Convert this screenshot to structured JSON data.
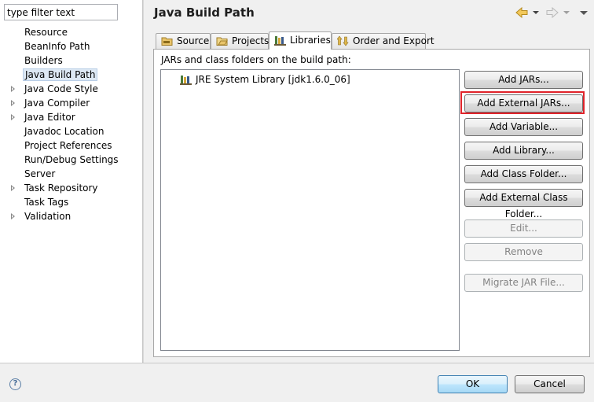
{
  "filter": {
    "placeholder": "type filter text"
  },
  "tree": {
    "items": [
      {
        "label": "Resource",
        "expandable": false,
        "selected": false
      },
      {
        "label": "BeanInfo Path",
        "expandable": false,
        "selected": false
      },
      {
        "label": "Builders",
        "expandable": false,
        "selected": false
      },
      {
        "label": "Java Build Path",
        "expandable": false,
        "selected": true
      },
      {
        "label": "Java Code Style",
        "expandable": true,
        "selected": false
      },
      {
        "label": "Java Compiler",
        "expandable": true,
        "selected": false
      },
      {
        "label": "Java Editor",
        "expandable": true,
        "selected": false
      },
      {
        "label": "Javadoc Location",
        "expandable": false,
        "selected": false
      },
      {
        "label": "Project References",
        "expandable": false,
        "selected": false
      },
      {
        "label": "Run/Debug Settings",
        "expandable": false,
        "selected": false
      },
      {
        "label": "Server",
        "expandable": false,
        "selected": false
      },
      {
        "label": "Task Repository",
        "expandable": true,
        "selected": false
      },
      {
        "label": "Task Tags",
        "expandable": false,
        "selected": false
      },
      {
        "label": "Validation",
        "expandable": true,
        "selected": false
      }
    ]
  },
  "header": {
    "title": "Java Build Path"
  },
  "tabs": [
    {
      "label": "Source",
      "icon": "source-folder-icon",
      "active": false
    },
    {
      "label": "Projects",
      "icon": "projects-icon",
      "active": false
    },
    {
      "label": "Libraries",
      "icon": "libraries-icon",
      "active": true
    },
    {
      "label": "Order and Export",
      "icon": "order-export-icon",
      "active": false
    }
  ],
  "libraries": {
    "caption": "JARs and class folders on the build path:",
    "entries": [
      {
        "label": "JRE System Library [jdk1.6.0_06]",
        "icon": "jre-library-icon"
      }
    ]
  },
  "buttons": {
    "add_jars": "Add JARs...",
    "add_external_jars": "Add External JARs...",
    "add_variable": "Add Variable...",
    "add_library": "Add Library...",
    "add_class_folder": "Add Class Folder...",
    "add_external_class_folder": "Add External Class Folder...",
    "edit": "Edit...",
    "remove": "Remove",
    "migrate_jar": "Migrate JAR File..."
  },
  "footer": {
    "help": "?",
    "ok": "OK",
    "cancel": "Cancel"
  },
  "colors": {
    "highlight": "#e0232a",
    "selection": "#dde8f4",
    "nav_arrow": "#e8b84a"
  }
}
